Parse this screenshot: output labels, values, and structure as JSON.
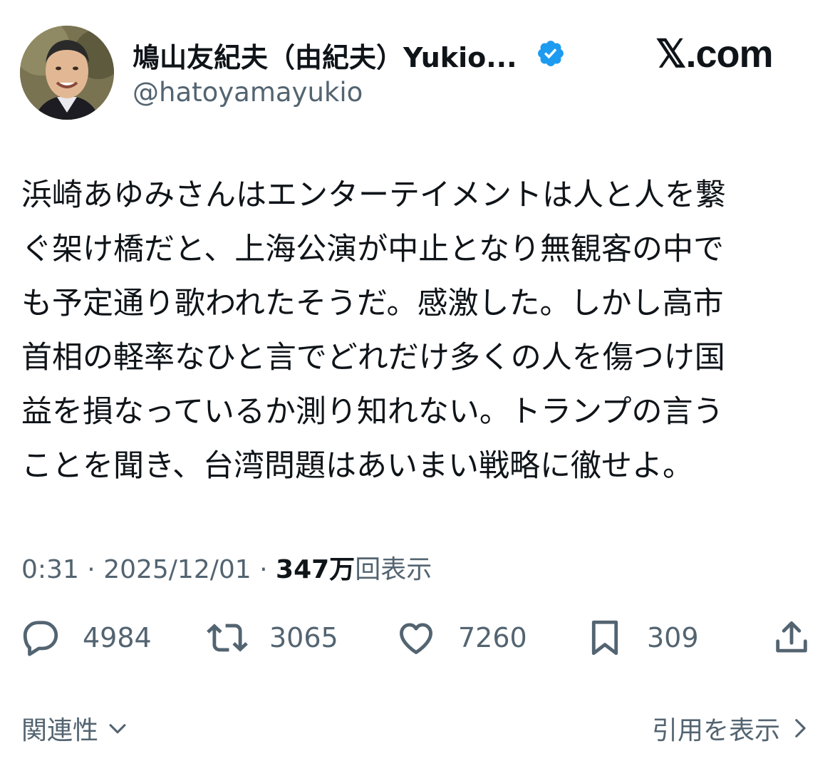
{
  "header": {
    "display_name": "鳩山友紀夫（由紀夫）Yukio...",
    "handle": "@hatoyamayukio",
    "verified": true,
    "brand": "𝕏.com"
  },
  "tweet": {
    "lines": [
      "浜崎あゆみさんはエンターテイメントは人と人を繋",
      "ぐ架け橋だと、上海公演が中止となり無観客の中で",
      "も予定通り歌われたそうだ。感激した。しかし高市",
      "首相の軽率なひと言でどれだけ多くの人を傷つけ国",
      "益を損なっているか測り知れない。トランプの言う",
      "ことを聞き、台湾問題はあいまい戦略に徹せよ。"
    ]
  },
  "meta": {
    "time": "0:31",
    "separator": " · ",
    "date": "2025/12/01",
    "views_number": "347万",
    "views_label": "回表示"
  },
  "actions": {
    "replies": "4984",
    "retweets": "3065",
    "likes": "7260",
    "bookmarks": "309"
  },
  "footer": {
    "related_label": "関連性",
    "quotes_label": "引用を表示"
  },
  "colors": {
    "text": "#0f1419",
    "secondary": "#536471",
    "verified_blue": "#1d9bf0"
  },
  "icons": [
    "reply-icon",
    "retweet-icon",
    "like-icon",
    "bookmark-icon",
    "share-icon",
    "verified-badge-icon",
    "chevron-down-icon",
    "chevron-right-icon"
  ]
}
